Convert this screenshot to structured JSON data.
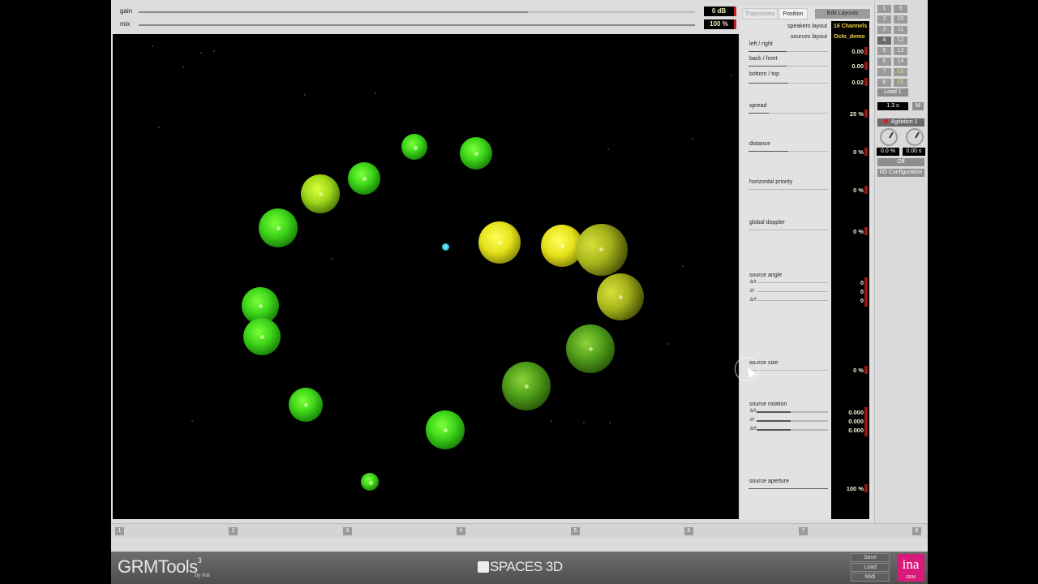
{
  "header": {
    "gain": {
      "label": "gain",
      "value": "0 dB",
      "level": 0.7
    },
    "mix": {
      "label": "mix",
      "value": "100 %",
      "level": 1.0
    }
  },
  "tabs": [
    {
      "label": "Trajectories",
      "active": false
    },
    {
      "label": "Position",
      "active": true
    }
  ],
  "edit_layouts_label": "Edit Layouts",
  "speakers_layout": {
    "label": "speakers layout",
    "value": "16 Channels"
  },
  "sources_layout": {
    "label": "sources layout",
    "value": "Octo_demo"
  },
  "params": {
    "left_right": {
      "label": "left / right",
      "value": "0.00"
    },
    "back_front": {
      "label": "back / front",
      "value": "0.00"
    },
    "bottom_top": {
      "label": "bottom / top",
      "value": "0.02"
    },
    "spread": {
      "label": "spread",
      "value": "25 %"
    },
    "distance": {
      "label": "distance",
      "value": "0 %"
    },
    "horizontal_priority": {
      "label": "horizontal priority",
      "value": "0 %"
    },
    "global_doppler": {
      "label": "global doppler",
      "value": "0 %"
    },
    "source_angle": {
      "label": "source angle",
      "rows": [
        {
          "label": "b/t",
          "value": "0"
        },
        {
          "label": "l/r",
          "value": "0"
        },
        {
          "label": "b/f",
          "value": "0"
        }
      ]
    },
    "source_size": {
      "label": "source size",
      "value": "0 %"
    },
    "source_rotation": {
      "label": "source rotation",
      "rows": [
        {
          "label": "b/t",
          "value": "0.000"
        },
        {
          "label": "l/r",
          "value": "0.000"
        },
        {
          "label": "b/f",
          "value": "0.000"
        }
      ]
    },
    "source_aperture": {
      "label": "source aperture",
      "value": "100 %"
    }
  },
  "presets": {
    "left": [
      "1",
      "2",
      "3",
      "4",
      "5",
      "6",
      "7",
      "8"
    ],
    "right": [
      "9",
      "10",
      "11",
      "12",
      "13",
      "14",
      "15",
      "16"
    ],
    "selected": "4",
    "highlighted": [
      "15",
      "16"
    ],
    "load_label": "Load 1",
    "time_value": "1.3 s",
    "m_label": "M",
    "agitation_label": "Agitation 1",
    "knob1_value": "0.0 %",
    "knob2_value": "0.00 s",
    "off_label": "Off",
    "io_label": "I/O Configuration"
  },
  "ruler": [
    "1",
    "2",
    "3",
    "4",
    "5",
    "6",
    "7",
    "8"
  ],
  "footer": {
    "brand": "GRMTools",
    "brand_sup": "3",
    "brand_by": "by ina",
    "product": "SPACES 3D",
    "buttons": [
      "Save",
      "Load",
      "Midi"
    ],
    "ina_logo": "ina",
    "ina_sub": "GRM"
  },
  "colors": {
    "sphere_green": "#3fd81a",
    "sphere_yellow": "#e6e21a",
    "listener": "#22c6d8",
    "value_text": "#f4efd8",
    "accent_red": "#9c1414",
    "ina_brand": "#d81b7a"
  }
}
